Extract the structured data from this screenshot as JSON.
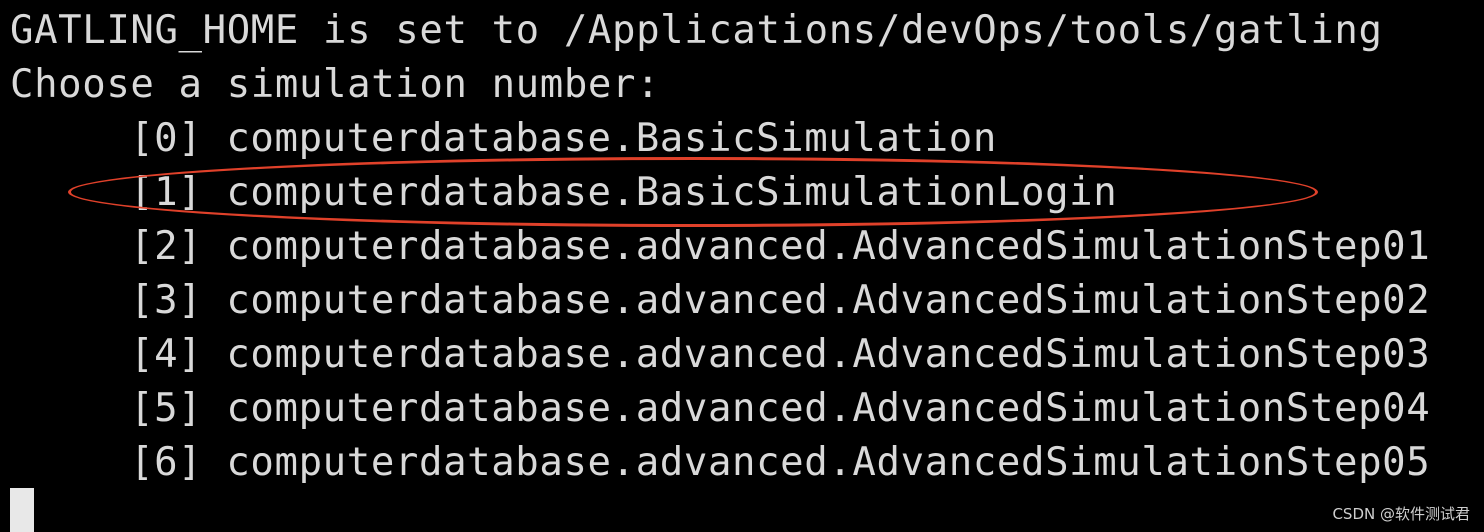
{
  "terminal": {
    "header_line": "GATLING_HOME is set to /Applications/devOps/tools/gatling",
    "prompt_line": "Choose a simulation number:",
    "options": [
      {
        "index": "[0]",
        "name": "computerdatabase.BasicSimulation"
      },
      {
        "index": "[1]",
        "name": "computerdatabase.BasicSimulationLogin"
      },
      {
        "index": "[2]",
        "name": "computerdatabase.advanced.AdvancedSimulationStep01"
      },
      {
        "index": "[3]",
        "name": "computerdatabase.advanced.AdvancedSimulationStep02"
      },
      {
        "index": "[4]",
        "name": "computerdatabase.advanced.AdvancedSimulationStep03"
      },
      {
        "index": "[5]",
        "name": "computerdatabase.advanced.AdvancedSimulationStep04"
      },
      {
        "index": "[6]",
        "name": "computerdatabase.advanced.AdvancedSimulationStep05"
      }
    ],
    "highlighted_option_index": 1,
    "highlight_color": "#e0412a",
    "text_color": "#d9d9d9",
    "background_color": "#000000"
  },
  "watermark": {
    "text": "CSDN @软件测试君"
  }
}
